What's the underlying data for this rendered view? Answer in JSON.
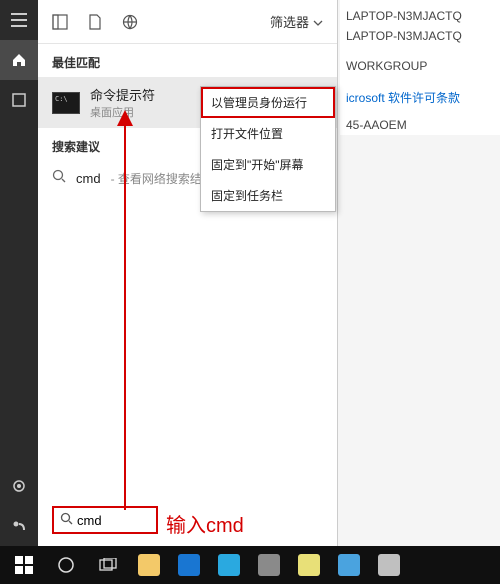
{
  "background": {
    "line1": "LAPTOP-N3MJACTQ",
    "line2": "LAPTOP-N3MJACTQ",
    "line3": "WORKGROUP",
    "link": "icrosoft 软件许可条款",
    "line5": "45-AAOEM"
  },
  "panel": {
    "filter_label": "筛选器",
    "best_match_label": "最佳匹配",
    "result": {
      "title": "命令提示符",
      "subtitle": "桌面应用"
    },
    "suggest_label": "搜索建议",
    "suggest_term": "cmd",
    "suggest_hint": "- 查看网络搜索结果"
  },
  "context_menu": {
    "run_admin": "以管理员身份运行",
    "open_location": "打开文件位置",
    "pin_start": "固定到\"开始\"屏幕",
    "pin_taskbar": "固定到任务栏"
  },
  "search_value": "cmd",
  "annotation": "输入cmd",
  "taskbar_apps": [
    {
      "name": "file-explorer",
      "color": "#f3c969"
    },
    {
      "name": "edge",
      "color": "#1976d2"
    },
    {
      "name": "ie",
      "color": "#2aa9e0"
    },
    {
      "name": "store",
      "color": "#8a8a8a"
    },
    {
      "name": "paint",
      "color": "#e8e078"
    },
    {
      "name": "app1",
      "color": "#4aa3df"
    },
    {
      "name": "app2",
      "color": "#c0c0c0"
    }
  ]
}
